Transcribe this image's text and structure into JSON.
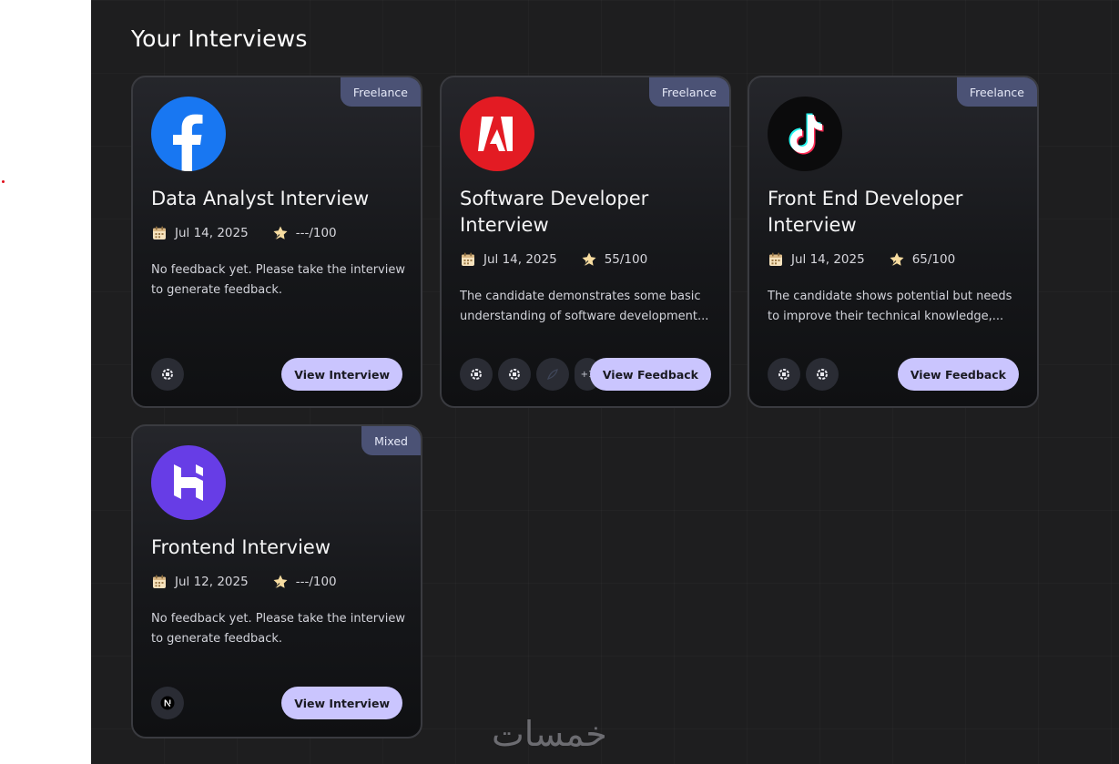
{
  "page": {
    "title": "Your Interviews"
  },
  "watermark": "خمسات",
  "colors": {
    "accent_button": "#cac5fe",
    "badge_bg": "#4b5275",
    "card_bg": "#16171a"
  },
  "interviews": [
    {
      "badge": "Freelance",
      "logo": "facebook-logo",
      "title": "Data Analyst Interview",
      "date": "Jul 14, 2025",
      "score": "---/100",
      "description": "No feedback yet. Please take the interview to generate feedback.",
      "tech_icons": [
        "devicon-generic-icon"
      ],
      "action_label": "View Interview"
    },
    {
      "badge": "Freelance",
      "logo": "adobe-logo",
      "title": "Software Developer Interview",
      "date": "Jul 14, 2025",
      "score": "55/100",
      "description": "The candidate demonstrates some basic understanding of software development...",
      "tech_icons": [
        "devicon-generic-icon",
        "devicon-generic-icon",
        "feather-icon"
      ],
      "more_count": "+1",
      "action_label": "View Feedback"
    },
    {
      "badge": "Freelance",
      "logo": "tiktok-logo",
      "title": "Front End Developer Interview",
      "date": "Jul 14, 2025",
      "score": "65/100",
      "description": "The candidate shows potential but needs to improve their technical knowledge,...",
      "tech_icons": [
        "devicon-generic-icon",
        "devicon-generic-icon"
      ],
      "action_label": "View Feedback"
    },
    {
      "badge": "Mixed",
      "logo": "hostinger-logo",
      "title": "Frontend Interview",
      "date": "Jul 12, 2025",
      "score": "---/100",
      "description": "No feedback yet. Please take the interview to generate feedback.",
      "tech_icons": [
        "nextjs-icon"
      ],
      "action_label": "View Interview"
    }
  ]
}
